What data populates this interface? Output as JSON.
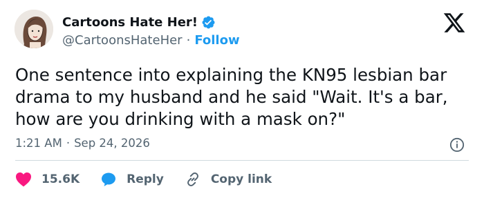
{
  "author": {
    "display_name": "Cartoons Hate Her!",
    "handle": "@CartoonsHateHer",
    "separator": "·",
    "follow_label": "Follow",
    "verified": true
  },
  "tweet": {
    "text": "One sentence into explaining the KN95 lesbian bar\ndrama to my husband and he said \"Wait. It's a bar,\nhow are you drinking with a mask on?\"",
    "time": "1:21 AM",
    "separator": "·",
    "date": "Sep 24, 2026"
  },
  "actions": {
    "likes": "15.6K",
    "reply_label": "Reply",
    "copy_link_label": "Copy link"
  },
  "colors": {
    "accent": "#1d9bf0",
    "like_red": "#f91880",
    "text_primary": "#0f1419",
    "text_secondary": "#536471",
    "divider": "#cfd9de"
  },
  "icons": [
    "avatar-illustration",
    "verified-badge-icon",
    "x-logo-icon",
    "info-icon",
    "heart-icon",
    "reply-bubble-icon",
    "link-icon"
  ]
}
